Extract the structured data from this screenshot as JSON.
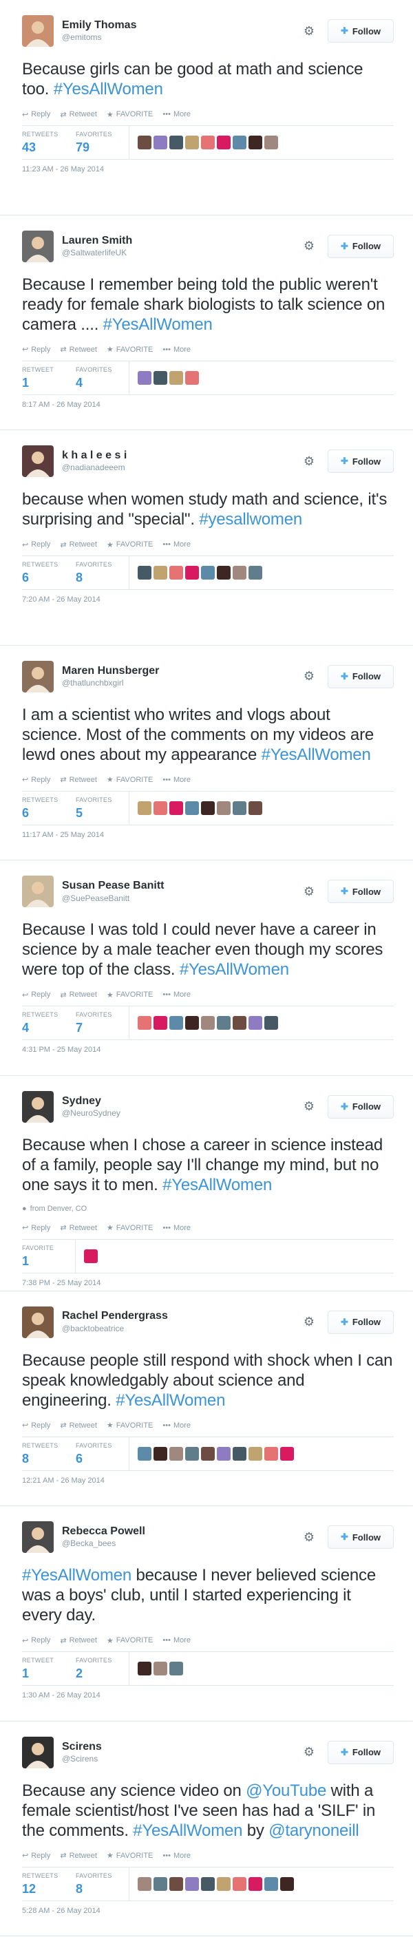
{
  "labels": {
    "follow": "Follow",
    "reply": "Reply",
    "retweet": "Retweet",
    "favorite": "FAVORITE",
    "more": "More",
    "retweets": "RETWEETS",
    "favorites": "FAVORITES",
    "retweet_stat": "RETWEET"
  },
  "colors": {
    "link": "#3b94d9",
    "muted": "#8899a6",
    "text": "#292f33",
    "follow_icon": "#55acee"
  },
  "tweets": [
    {
      "fullname": "Emily Thomas",
      "screenname": "@emitoms",
      "text": [
        {
          "t": "Because girls can be good at math and science too. ",
          "k": "plain"
        },
        {
          "t": "#YesAllWomen",
          "k": "hash"
        }
      ],
      "stats": [
        {
          "label": "RETWEETS",
          "value": "43"
        },
        {
          "label": "FAVORITES",
          "value": "79"
        }
      ],
      "faces": 9,
      "timestamp": "11:23 AM - 26 May 2014",
      "avatar_color": "#c98f6f"
    },
    {
      "fullname": "Lauren Smith",
      "screenname": "@SaltwaterlifeUK",
      "text": [
        {
          "t": "Because I remember being told the public weren't ready for female shark biologists to talk science on camera .... ",
          "k": "plain"
        },
        {
          "t": "#YesAllWomen",
          "k": "hash"
        }
      ],
      "stats": [
        {
          "label": "RETWEET",
          "value": "1"
        },
        {
          "label": "FAVORITES",
          "value": "4"
        }
      ],
      "faces": 4,
      "timestamp": "8:17 AM - 26 May 2014",
      "avatar_color": "#6b6b6b"
    },
    {
      "fullname": "k h a l e e s i",
      "screenname": "@nadianadeeem",
      "text": [
        {
          "t": "because when women study math and science, it's surprising and \"special\". ",
          "k": "plain"
        },
        {
          "t": "#yesallwomen",
          "k": "hash"
        }
      ],
      "stats": [
        {
          "label": "RETWEETS",
          "value": "6"
        },
        {
          "label": "FAVORITES",
          "value": "8"
        }
      ],
      "faces": 8,
      "timestamp": "7:20 AM - 26 May 2014",
      "avatar_color": "#5b3b3b"
    },
    {
      "fullname": "Maren Hunsberger",
      "screenname": "@thatlunchbxgirl",
      "text": [
        {
          "t": "I am a scientist who writes and vlogs about science. Most of the comments on my videos are lewd ones about my appearance ",
          "k": "plain"
        },
        {
          "t": "#YesAllWomen",
          "k": "hash"
        }
      ],
      "stats": [
        {
          "label": "RETWEETS",
          "value": "6"
        },
        {
          "label": "FAVORITES",
          "value": "5"
        }
      ],
      "faces": 8,
      "timestamp": "11:17 AM - 25 May 2014",
      "avatar_color": "#8a6f5a"
    },
    {
      "fullname": "Susan Pease Banitt",
      "screenname": "@SuePeaseBanitt",
      "text": [
        {
          "t": "Because I was told I could never have a career in science by a male teacher even though my scores were top of the class. ",
          "k": "plain"
        },
        {
          "t": "#YesAllWomen",
          "k": "hash"
        }
      ],
      "stats": [
        {
          "label": "RETWEETS",
          "value": "4"
        },
        {
          "label": "FAVORITES",
          "value": "7"
        }
      ],
      "faces": 9,
      "timestamp": "4:31 PM - 25 May 2014",
      "avatar_color": "#c9b89a"
    },
    {
      "fullname": "Sydney",
      "screenname": "@NeuroSydney",
      "text": [
        {
          "t": "Because when I chose a career in science instead of a family, people say I'll change my mind, but no one says it to men. ",
          "k": "plain"
        },
        {
          "t": "#YesAllWomen",
          "k": "hash"
        }
      ],
      "location": "from Denver, CO",
      "stats": [
        {
          "label": "FAVORITE",
          "value": "1"
        }
      ],
      "faces": 1,
      "timestamp": "7:38 PM - 25 May 2014",
      "avatar_color": "#3a3a3a"
    },
    {
      "fullname": "Rachel Pendergrass",
      "screenname": "@backtobeatrice",
      "text": [
        {
          "t": "Because people still respond with shock when I can speak knowledgably about science and engineering. ",
          "k": "plain"
        },
        {
          "t": "#YesAllWomen",
          "k": "hash"
        }
      ],
      "stats": [
        {
          "label": "RETWEETS",
          "value": "8"
        },
        {
          "label": "FAVORITES",
          "value": "6"
        }
      ],
      "faces": 10,
      "timestamp": "12:21 AM - 26 May 2014",
      "avatar_color": "#7a5a40"
    },
    {
      "fullname": "Rebecca Powell",
      "screenname": "@Becka_bees",
      "text": [
        {
          "t": "#YesAllWomen",
          "k": "hash"
        },
        {
          "t": " because I never believed science was a boys' club, until I started experiencing it every day.",
          "k": "plain"
        }
      ],
      "stats": [
        {
          "label": "RETWEET",
          "value": "1"
        },
        {
          "label": "FAVORITES",
          "value": "2"
        }
      ],
      "faces": 3,
      "timestamp": "1:30 AM - 26 May 2014",
      "avatar_color": "#4a4a4a"
    },
    {
      "fullname": "Scirens",
      "screenname": "@Scirens",
      "text": [
        {
          "t": "Because any science video on ",
          "k": "plain"
        },
        {
          "t": "@YouTube",
          "k": "mention"
        },
        {
          "t": " with a female scientist/host I've seen has had a 'SILF' in the comments. ",
          "k": "plain"
        },
        {
          "t": "#YesAllWomen",
          "k": "hash"
        },
        {
          "t": " by ",
          "k": "plain"
        },
        {
          "t": "@tarynoneill",
          "k": "mention"
        }
      ],
      "stats": [
        {
          "label": "RETWEETS",
          "value": "12"
        },
        {
          "label": "FAVORITES",
          "value": "8"
        }
      ],
      "faces": 10,
      "timestamp": "5:28 AM - 26 May 2014",
      "avatar_color": "#2f2f2f"
    }
  ]
}
